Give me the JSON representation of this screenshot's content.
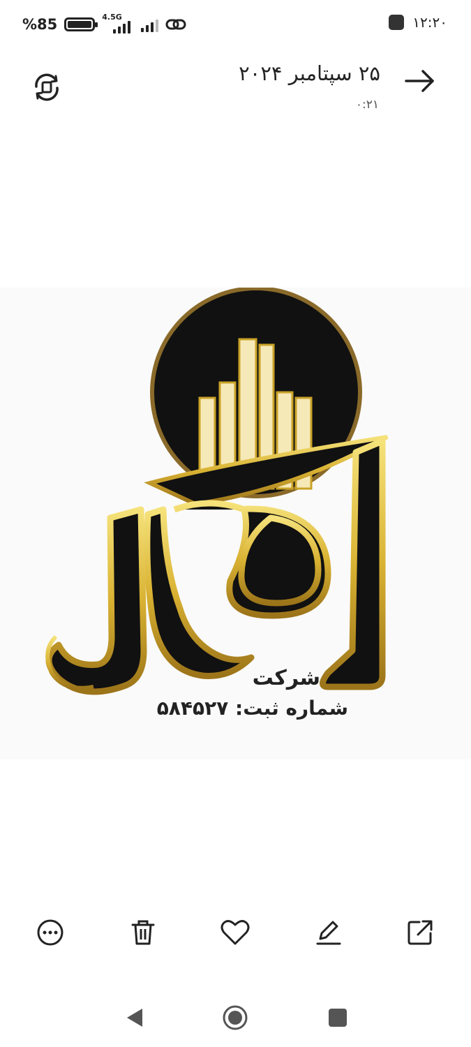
{
  "status_bar": {
    "battery_percent": "%85",
    "network_type": "4.5G",
    "time": "۱۲:۲۰"
  },
  "header": {
    "date": "۲۵ سپتامبر ۲۰۲۴",
    "time": "۰:۲۱",
    "back_icon": "arrow-right-icon",
    "rotate_icon": "rotate-icon"
  },
  "photo": {
    "logo_company": "شرکت",
    "logo_registration": "شماره ثبت: ۵۸۴۵۲۷",
    "colors": {
      "gold": "#c9a227",
      "black": "#111111"
    }
  },
  "actions": [
    {
      "icon": "more-icon"
    },
    {
      "icon": "trash-icon"
    },
    {
      "icon": "heart-icon"
    },
    {
      "icon": "edit-icon"
    },
    {
      "icon": "share-icon"
    }
  ],
  "nav": [
    {
      "icon": "nav-back-icon"
    },
    {
      "icon": "nav-home-icon"
    },
    {
      "icon": "nav-recents-icon"
    }
  ]
}
